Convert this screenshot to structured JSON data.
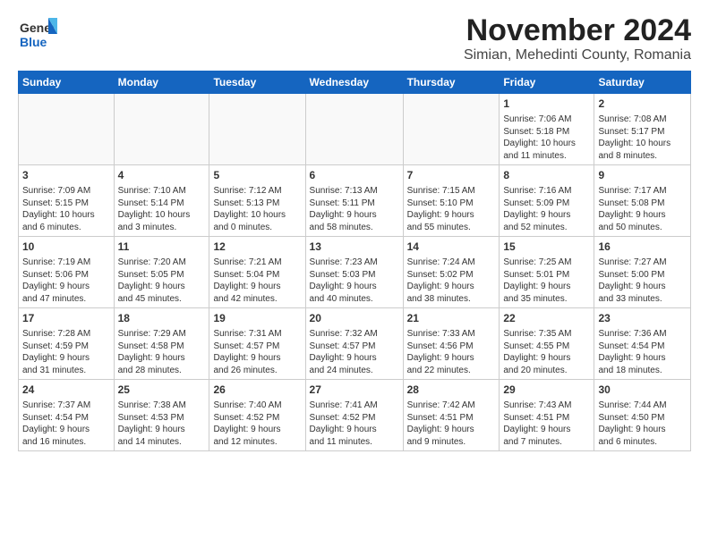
{
  "logo": {
    "line1": "General",
    "line2": "Blue"
  },
  "title": "November 2024",
  "subtitle": "Simian, Mehedinti County, Romania",
  "weekdays": [
    "Sunday",
    "Monday",
    "Tuesday",
    "Wednesday",
    "Thursday",
    "Friday",
    "Saturday"
  ],
  "weeks": [
    [
      {
        "day": "",
        "info": ""
      },
      {
        "day": "",
        "info": ""
      },
      {
        "day": "",
        "info": ""
      },
      {
        "day": "",
        "info": ""
      },
      {
        "day": "",
        "info": ""
      },
      {
        "day": "1",
        "info": "Sunrise: 7:06 AM\nSunset: 5:18 PM\nDaylight: 10 hours\nand 11 minutes."
      },
      {
        "day": "2",
        "info": "Sunrise: 7:08 AM\nSunset: 5:17 PM\nDaylight: 10 hours\nand 8 minutes."
      }
    ],
    [
      {
        "day": "3",
        "info": "Sunrise: 7:09 AM\nSunset: 5:15 PM\nDaylight: 10 hours\nand 6 minutes."
      },
      {
        "day": "4",
        "info": "Sunrise: 7:10 AM\nSunset: 5:14 PM\nDaylight: 10 hours\nand 3 minutes."
      },
      {
        "day": "5",
        "info": "Sunrise: 7:12 AM\nSunset: 5:13 PM\nDaylight: 10 hours\nand 0 minutes."
      },
      {
        "day": "6",
        "info": "Sunrise: 7:13 AM\nSunset: 5:11 PM\nDaylight: 9 hours\nand 58 minutes."
      },
      {
        "day": "7",
        "info": "Sunrise: 7:15 AM\nSunset: 5:10 PM\nDaylight: 9 hours\nand 55 minutes."
      },
      {
        "day": "8",
        "info": "Sunrise: 7:16 AM\nSunset: 5:09 PM\nDaylight: 9 hours\nand 52 minutes."
      },
      {
        "day": "9",
        "info": "Sunrise: 7:17 AM\nSunset: 5:08 PM\nDaylight: 9 hours\nand 50 minutes."
      }
    ],
    [
      {
        "day": "10",
        "info": "Sunrise: 7:19 AM\nSunset: 5:06 PM\nDaylight: 9 hours\nand 47 minutes."
      },
      {
        "day": "11",
        "info": "Sunrise: 7:20 AM\nSunset: 5:05 PM\nDaylight: 9 hours\nand 45 minutes."
      },
      {
        "day": "12",
        "info": "Sunrise: 7:21 AM\nSunset: 5:04 PM\nDaylight: 9 hours\nand 42 minutes."
      },
      {
        "day": "13",
        "info": "Sunrise: 7:23 AM\nSunset: 5:03 PM\nDaylight: 9 hours\nand 40 minutes."
      },
      {
        "day": "14",
        "info": "Sunrise: 7:24 AM\nSunset: 5:02 PM\nDaylight: 9 hours\nand 38 minutes."
      },
      {
        "day": "15",
        "info": "Sunrise: 7:25 AM\nSunset: 5:01 PM\nDaylight: 9 hours\nand 35 minutes."
      },
      {
        "day": "16",
        "info": "Sunrise: 7:27 AM\nSunset: 5:00 PM\nDaylight: 9 hours\nand 33 minutes."
      }
    ],
    [
      {
        "day": "17",
        "info": "Sunrise: 7:28 AM\nSunset: 4:59 PM\nDaylight: 9 hours\nand 31 minutes."
      },
      {
        "day": "18",
        "info": "Sunrise: 7:29 AM\nSunset: 4:58 PM\nDaylight: 9 hours\nand 28 minutes."
      },
      {
        "day": "19",
        "info": "Sunrise: 7:31 AM\nSunset: 4:57 PM\nDaylight: 9 hours\nand 26 minutes."
      },
      {
        "day": "20",
        "info": "Sunrise: 7:32 AM\nSunset: 4:57 PM\nDaylight: 9 hours\nand 24 minutes."
      },
      {
        "day": "21",
        "info": "Sunrise: 7:33 AM\nSunset: 4:56 PM\nDaylight: 9 hours\nand 22 minutes."
      },
      {
        "day": "22",
        "info": "Sunrise: 7:35 AM\nSunset: 4:55 PM\nDaylight: 9 hours\nand 20 minutes."
      },
      {
        "day": "23",
        "info": "Sunrise: 7:36 AM\nSunset: 4:54 PM\nDaylight: 9 hours\nand 18 minutes."
      }
    ],
    [
      {
        "day": "24",
        "info": "Sunrise: 7:37 AM\nSunset: 4:54 PM\nDaylight: 9 hours\nand 16 minutes."
      },
      {
        "day": "25",
        "info": "Sunrise: 7:38 AM\nSunset: 4:53 PM\nDaylight: 9 hours\nand 14 minutes."
      },
      {
        "day": "26",
        "info": "Sunrise: 7:40 AM\nSunset: 4:52 PM\nDaylight: 9 hours\nand 12 minutes."
      },
      {
        "day": "27",
        "info": "Sunrise: 7:41 AM\nSunset: 4:52 PM\nDaylight: 9 hours\nand 11 minutes."
      },
      {
        "day": "28",
        "info": "Sunrise: 7:42 AM\nSunset: 4:51 PM\nDaylight: 9 hours\nand 9 minutes."
      },
      {
        "day": "29",
        "info": "Sunrise: 7:43 AM\nSunset: 4:51 PM\nDaylight: 9 hours\nand 7 minutes."
      },
      {
        "day": "30",
        "info": "Sunrise: 7:44 AM\nSunset: 4:50 PM\nDaylight: 9 hours\nand 6 minutes."
      }
    ]
  ]
}
